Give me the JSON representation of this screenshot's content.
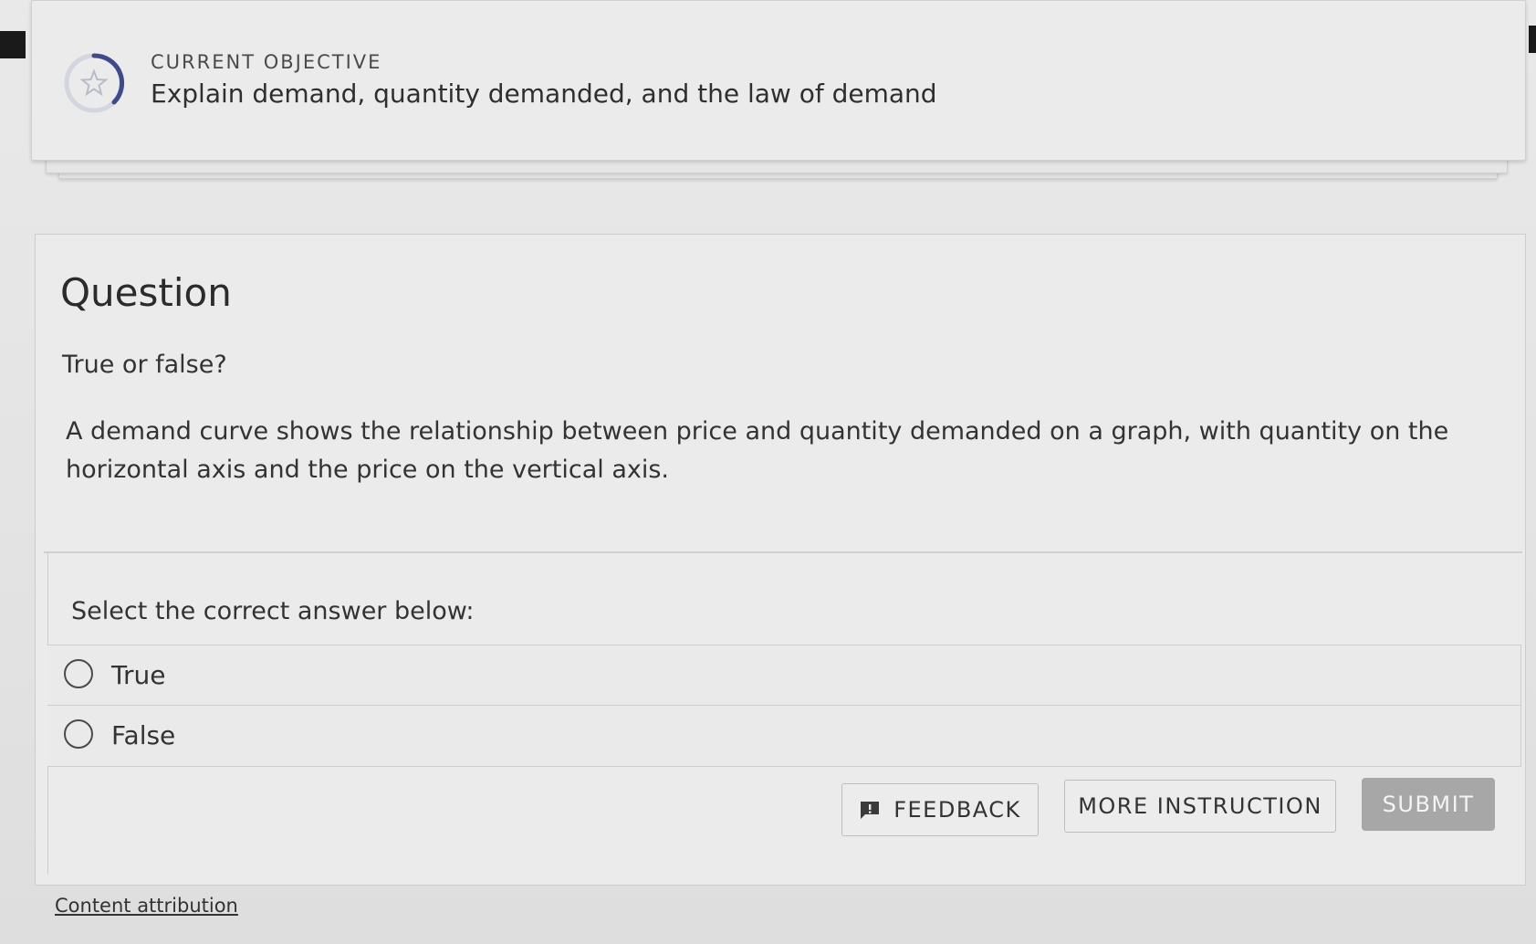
{
  "objective": {
    "label": "CURRENT OBJECTIVE",
    "title": "Explain demand, quantity demanded, and the law of demand"
  },
  "question": {
    "heading": "Question",
    "prompt": "True or false?",
    "statement": "A demand curve shows the relationship between price and quantity demanded on a graph, with quantity on the horizontal axis and the price on the vertical axis."
  },
  "answers": {
    "instruction": "Select the correct answer below:",
    "options": [
      {
        "label": "True"
      },
      {
        "label": "False"
      }
    ]
  },
  "actions": {
    "feedback_label": "FEEDBACK",
    "more_instruction_label": "MORE INSTRUCTION",
    "submit_label": "SUBMIT"
  },
  "footer": {
    "attribution_label": "Content attribution"
  },
  "icons": {
    "objective": "star-icon",
    "feedback": "feedback-icon"
  },
  "colors": {
    "ring_progress": "#3f4a8a",
    "ring_track": "#d3d5df",
    "submit_bg": "#a7a7a7"
  }
}
